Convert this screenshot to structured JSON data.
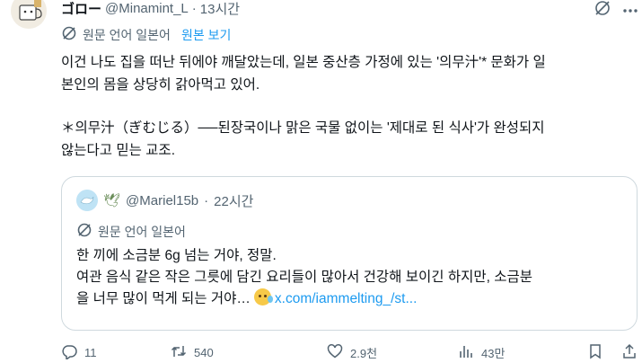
{
  "tweet": {
    "display_name": "ゴロー",
    "handle": "@Minamint_L",
    "separator": "·",
    "time": "13시간",
    "translate": {
      "label": "원문 언어 일본어",
      "show_original": "원본 보기"
    },
    "text_lines": [
      "이건 나도 집을 떠난 뒤에야 깨달았는데, 일본 중산층 가정에 있는 '의무汁'* 문화가 일",
      "본인의 몸을 상당히 갉아먹고 있어.",
      "＊의무汁（ぎむじる）──된장국이나 맑은 국물 없이는 '제대로 된 식사'가 완성되지",
      "않는다고 믿는 교조."
    ]
  },
  "quote": {
    "handle": "@Mariel15b",
    "separator": "·",
    "time": "22시간",
    "translate_label": "원문 언어 일본어",
    "text_line1": "한 끼에 소금분 6g 넘는 거야, 정말.",
    "text_line2": "여관 음식 같은 작은 그릇에 담긴 요리들이 많아서 건강해 보이긴 하지만, 소금분",
    "text_line3_prefix": "을 너무 많이 먹게 되는 거야…",
    "link": "x.com/iammelting_/st..."
  },
  "actions": {
    "replies": "11",
    "retweets": "540",
    "likes": "2.9천",
    "views": "43만"
  },
  "colors": {
    "accent": "#1d9bf0",
    "secondary_text": "#536471",
    "border": "#cfd9de"
  }
}
